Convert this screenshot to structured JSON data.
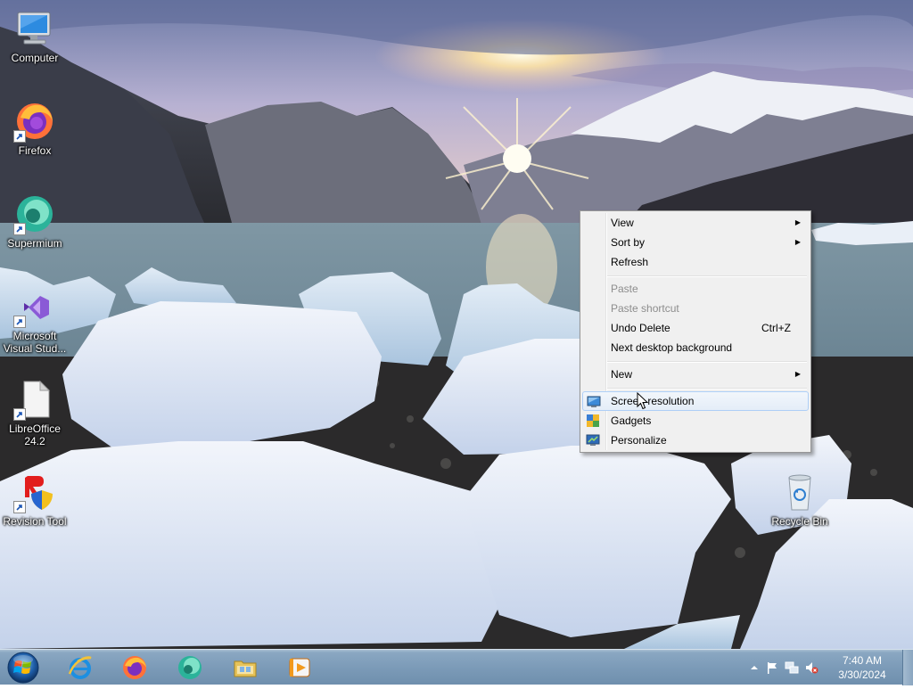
{
  "desktop": {
    "icons": [
      {
        "name": "computer",
        "label": "Computer"
      },
      {
        "name": "firefox",
        "label": "Firefox"
      },
      {
        "name": "supermium",
        "label": "Supermium"
      },
      {
        "name": "visual-studio",
        "label": "Microsoft Visual Stud..."
      },
      {
        "name": "libreoffice",
        "label": "LibreOffice 24.2"
      },
      {
        "name": "revision-tool",
        "label": "Revision Tool"
      },
      {
        "name": "recycle-bin",
        "label": "Recycle Bin"
      }
    ]
  },
  "context_menu": {
    "items": [
      {
        "label": "View",
        "submenu": true
      },
      {
        "label": "Sort by",
        "submenu": true
      },
      {
        "label": "Refresh"
      },
      {
        "label": "Paste",
        "disabled": true
      },
      {
        "label": "Paste shortcut",
        "disabled": true
      },
      {
        "label": "Undo Delete",
        "shortcut": "Ctrl+Z"
      },
      {
        "label": "Next desktop background"
      },
      {
        "label": "New",
        "submenu": true
      },
      {
        "label": "Screen resolution",
        "icon": "monitor-icon",
        "highlighted": true
      },
      {
        "label": "Gadgets",
        "icon": "gadgets-icon"
      },
      {
        "label": "Personalize",
        "icon": "personalize-icon"
      }
    ],
    "arrow_glyph": "▶"
  },
  "taskbar": {
    "pinned": [
      "internet-explorer",
      "firefox",
      "supermium",
      "file-explorer",
      "media-player"
    ],
    "tray": {
      "time": "7:40 AM",
      "date": "3/30/2024"
    }
  },
  "colors": {
    "taskbar": "#7c9bb8",
    "menu_bg": "#f0f0f0",
    "menu_highlight": "#e4edf8"
  }
}
